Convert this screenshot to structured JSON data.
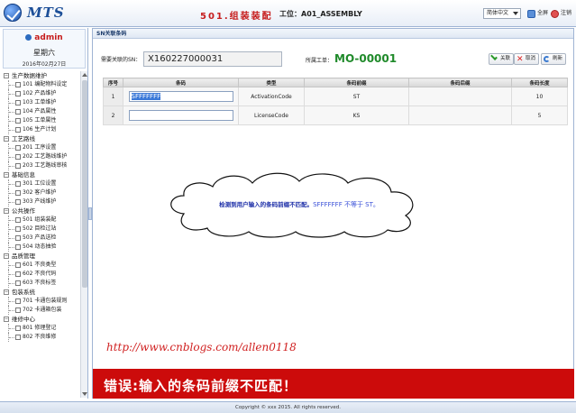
{
  "header": {
    "app_name": "MTS",
    "station": "501.组装装配",
    "station_code": "工位：A01_ASSEMBLY",
    "language": "简体中文",
    "fullscreen_label": "全屏",
    "logout_label": "注销"
  },
  "user": {
    "name": "admin",
    "weekday": "星期六",
    "date": "2016年02月27日"
  },
  "menu": [
    {
      "group": "生产数据维护",
      "items": [
        "101 编配物料设定",
        "102 产品维护",
        "103 工单维护",
        "104 产品属性",
        "105 工单属性",
        "106 生产计划"
      ]
    },
    {
      "group": "工艺路线",
      "items": [
        "201 工序设置",
        "202 工艺路线维护",
        "203 工艺路线审核"
      ]
    },
    {
      "group": "基础信息",
      "items": [
        "301 工位设置",
        "302 客户维护",
        "303 产线维护"
      ]
    },
    {
      "group": "公共操作",
      "items": [
        "501 组装装配",
        "502 目检过站",
        "503 产品送检",
        "504 动态抽验"
      ]
    },
    {
      "group": "品质管理",
      "items": [
        "601 不良类型",
        "602 不良代码",
        "603 不良标签"
      ]
    },
    {
      "group": "包装系统",
      "items": [
        "701 卡通包装规则",
        "702 卡通箱包装"
      ]
    },
    {
      "group": "维修中心",
      "items": [
        "801 修理登记",
        "802 不良维修"
      ]
    }
  ],
  "panel": {
    "title": "SN关联条码",
    "sn_label": "需要关联的SN：",
    "sn_value": "X160227000031",
    "order_label": "所属工单：",
    "order_value": "MO-00001",
    "btn_link": "关联",
    "btn_cancel": "取消",
    "btn_refresh": "刷新"
  },
  "table": {
    "headers": [
      "序号",
      "条码",
      "类型",
      "条码前缀",
      "条码后缀",
      "条码长度"
    ],
    "rows": [
      {
        "index": "1",
        "barcode": "SFFFFFFF",
        "type": "ActivationCode",
        "prefix": "ST",
        "suffix": "",
        "length": "10"
      },
      {
        "index": "2",
        "barcode": "",
        "type": "LicenseCode",
        "prefix": "KS",
        "suffix": "",
        "length": "5"
      }
    ]
  },
  "bubble": {
    "text": "检测到用户输入的条码前缀不匹配。",
    "detail": "SFFFFFFF 不等于 ST。"
  },
  "watermark": "http://www.cnblogs.com/allen0118",
  "error": "错误:输入的条码前缀不匹配！",
  "footer": "Copyright © xxx 2015. All rights reserved.",
  "colors": {
    "accent": "#1d4f98",
    "station": "#c61d1d",
    "order": "#1f8a2a",
    "error_bar": "#cc0b0b",
    "bubble_text": "#1d2fa8"
  }
}
